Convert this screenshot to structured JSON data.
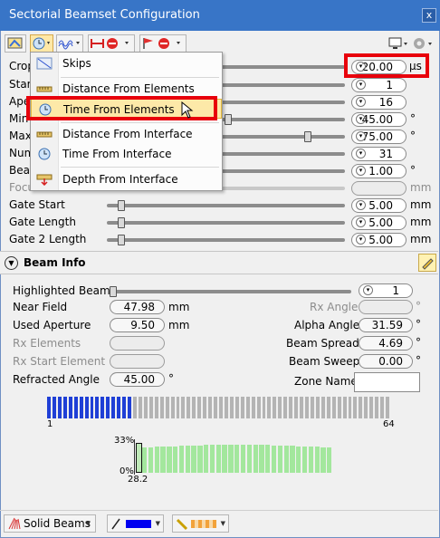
{
  "window": {
    "title": "Sectorial Beamset Configuration",
    "close_label": "x"
  },
  "menu": {
    "items": [
      {
        "label": "Skips",
        "icon": "skips-icon"
      },
      {
        "label": "Distance From Elements",
        "icon": "ruler-icon"
      },
      {
        "label": "Time From Elements",
        "icon": "clock-icon"
      },
      {
        "label": "Distance From Interface",
        "icon": "ruler-icon"
      },
      {
        "label": "Time From Interface",
        "icon": "clock-icon"
      },
      {
        "label": "Depth From Interface",
        "icon": "depth-icon"
      }
    ]
  },
  "params": {
    "crop": {
      "label": "Crop",
      "value": "20.00",
      "unit": "µs"
    },
    "start": {
      "label": "Start",
      "value": "1"
    },
    "aperture": {
      "label": "Ape",
      "value": "16"
    },
    "min": {
      "label": "Min",
      "value": "45.00",
      "unit": "°"
    },
    "max": {
      "label": "Max",
      "value": "75.00",
      "unit": "°"
    },
    "num": {
      "label": "Num",
      "value": "31"
    },
    "beam": {
      "label": "Beam",
      "value": "1.00",
      "unit": "°"
    },
    "focus": {
      "label": "Focu",
      "unit": "mm"
    },
    "gate_start": {
      "label": "Gate Start",
      "value": "5.00",
      "unit": "mm"
    },
    "gate_length": {
      "label": "Gate Length",
      "value": "5.00",
      "unit": "mm"
    },
    "gate2_length": {
      "label": "Gate 2 Length",
      "value": "5.00",
      "unit": "mm"
    }
  },
  "beam_info": {
    "title": "Beam Info",
    "highlighted_beam": {
      "label": "Highlighted Beam",
      "value": "1"
    },
    "near_field": {
      "label": "Near Field",
      "value": "47.98",
      "unit": "mm"
    },
    "used_aperture": {
      "label": "Used Aperture",
      "value": "9.50",
      "unit": "mm"
    },
    "rx_elements": {
      "label": "Rx Elements"
    },
    "rx_start_element": {
      "label": "Rx Start Element"
    },
    "refracted_angle": {
      "label": "Refracted Angle",
      "value": "45.00",
      "unit": "°"
    },
    "rx_angle": {
      "label": "Rx Angle",
      "unit": "°"
    },
    "alpha_angle": {
      "label": "Alpha Angle",
      "value": "31.59",
      "unit": "°"
    },
    "beam_spread": {
      "label": "Beam Spread",
      "value": "4.69",
      "unit": "°"
    },
    "beam_sweep": {
      "label": "Beam Sweep",
      "value": "0.00",
      "unit": "°"
    },
    "zone_name": {
      "label": "Zone Name",
      "value": ""
    },
    "elements_first": "1",
    "elements_last": "64",
    "elements_total": 64,
    "elements_active": 16,
    "profile_top": "33%",
    "profile_bottom": "0%",
    "profile_value": "28.2"
  },
  "bottom": {
    "beams_label": "Solid Beams"
  },
  "colors": {
    "title_bar": "#3875c7",
    "highlight": "#fde9a8",
    "active_element": "#1f3fd6",
    "profile_bar": "#a3e79d",
    "annotation": "#e8000b"
  }
}
